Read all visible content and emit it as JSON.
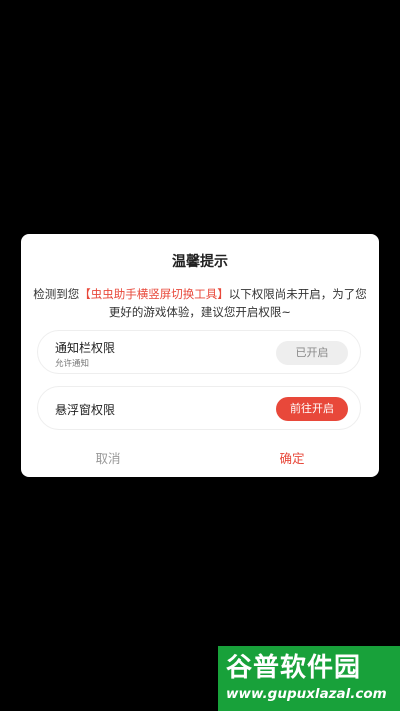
{
  "dialog": {
    "title": "温馨提示",
    "message_prefix": "检测到您",
    "message_app": "【虫虫助手横竖屏切换工具】",
    "message_suffix": "以下权限尚未开启，为了您",
    "message_line2": "更好的游戏体验，建议您开启权限~",
    "permissions": [
      {
        "name": "通知栏权限",
        "description": "允许通知",
        "button": "已开启",
        "status": "enabled"
      },
      {
        "name": "悬浮窗权限",
        "button": "前往开启",
        "status": "disabled"
      }
    ],
    "cancel_label": "取消",
    "confirm_label": "确定"
  },
  "watermark": {
    "logo": "谷普软件园",
    "url": "www.gupuxlazal.com"
  },
  "colors": {
    "accent": "#e8483a",
    "background": "#000000",
    "watermark": "#18a13a"
  }
}
